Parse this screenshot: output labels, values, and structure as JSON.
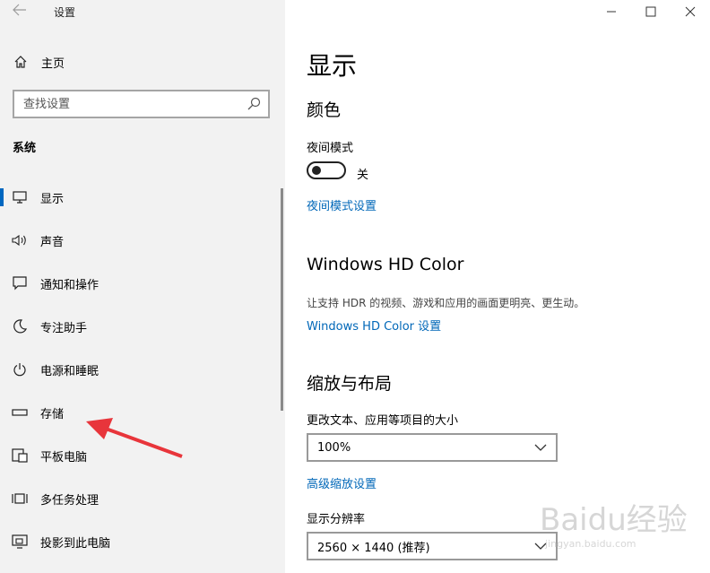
{
  "app": {
    "title": "设置",
    "back_glyph": "←"
  },
  "window_controls": {
    "minimize": "—",
    "maximize": "☐",
    "close": "✕"
  },
  "sidebar": {
    "home_label": "主页",
    "search_placeholder": "查找设置",
    "section_title": "系统",
    "items": [
      {
        "label": "显示",
        "icon": "monitor-icon",
        "active": true
      },
      {
        "label": "声音",
        "icon": "speaker-icon"
      },
      {
        "label": "通知和操作",
        "icon": "notification-icon"
      },
      {
        "label": "专注助手",
        "icon": "moon-icon"
      },
      {
        "label": "电源和睡眠",
        "icon": "power-icon"
      },
      {
        "label": "存储",
        "icon": "storage-icon"
      },
      {
        "label": "平板电脑",
        "icon": "tablet-icon"
      },
      {
        "label": "多任务处理",
        "icon": "multitask-icon"
      },
      {
        "label": "投影到此电脑",
        "icon": "project-icon"
      }
    ]
  },
  "main": {
    "title": "显示",
    "color_section": "颜色",
    "night_mode_label": "夜间模式",
    "night_mode_state": "关",
    "night_mode_link": "夜间模式设置",
    "hdr_section": "Windows HD Color",
    "hdr_desc": "让支持 HDR 的视频、游戏和应用的画面更明亮、更生动。",
    "hdr_link": "Windows HD Color 设置",
    "scale_section": "缩放与布局",
    "scale_label": "更改文本、应用等项目的大小",
    "scale_value": "100%",
    "scale_link": "高级缩放设置",
    "resolution_label": "显示分辨率",
    "resolution_value": "2560 × 1440 (推荐)"
  },
  "watermark": {
    "brand": "Baidu经验",
    "sub": "jingyan.baidu.com"
  },
  "colors": {
    "accent": "#0067b8",
    "sidebar_bg": "#f2f2f2",
    "annotation_arrow": "#e8353b"
  }
}
